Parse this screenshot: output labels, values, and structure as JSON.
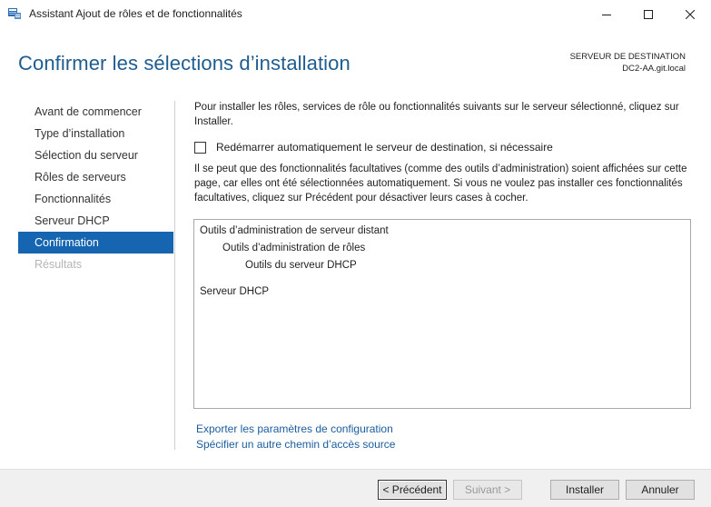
{
  "window": {
    "title": "Assistant Ajout de rôles et de fonctionnalités",
    "controls": [
      "minimize-icon",
      "maximize-icon",
      "close-icon"
    ]
  },
  "header": {
    "title": "Confirmer les sélections d’installation",
    "destination_label": "SERVEUR DE DESTINATION",
    "destination_server": "DC2-AA.git.local"
  },
  "sidebar": {
    "items": [
      {
        "label": "Avant de commencer",
        "state": "normal"
      },
      {
        "label": "Type d’installation",
        "state": "normal"
      },
      {
        "label": "Sélection du serveur",
        "state": "normal"
      },
      {
        "label": "Rôles de serveurs",
        "state": "normal"
      },
      {
        "label": "Fonctionnalités",
        "state": "normal"
      },
      {
        "label": "Serveur DHCP",
        "state": "normal"
      },
      {
        "label": "Confirmation",
        "state": "active"
      },
      {
        "label": "Résultats",
        "state": "disabled"
      }
    ]
  },
  "main": {
    "intro": "Pour installer les rôles, services de rôle ou fonctionnalités suivants sur le serveur sélectionné, cliquez sur Installer.",
    "restart_checkbox": {
      "label": "Redémarrer automatiquement le serveur de destination, si nécessaire",
      "checked": false
    },
    "note": "Il se peut que des fonctionnalités facultatives (comme des outils d’administration) soient affichées sur cette page, car elles ont été sélectionnées automatiquement. Si vous ne voulez pas installer ces fonctionnalités facultatives, cliquez sur Précédent pour désactiver leurs cases à cocher.",
    "selections": [
      "Outils d’administration de serveur distant",
      "Outils d’administration de rôles",
      "Outils du serveur DHCP",
      "Serveur DHCP"
    ],
    "links": {
      "export": "Exporter les paramètres de configuration",
      "alternate_source": "Spécifier un autre chemin d’accès source"
    }
  },
  "footer": {
    "previous": "< Précédent",
    "next": "Suivant >",
    "install": "Installer",
    "cancel": "Annuler"
  },
  "colors": {
    "title_blue": "#1f5c8f",
    "active_nav": "#1565b0",
    "link_blue": "#1a5c9e"
  }
}
